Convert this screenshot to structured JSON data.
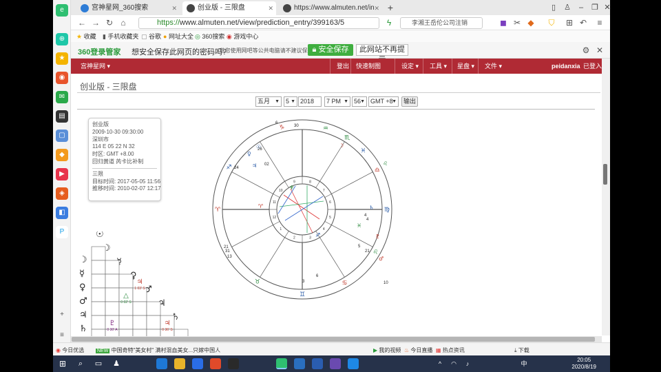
{
  "browser": {
    "tabs": [
      {
        "label": "宫神星网_360搜索"
      },
      {
        "label": "创业版 - 三限盘",
        "active": true
      },
      {
        "label": "https://www.almuten.net/in"
      }
    ],
    "new_tab": "+",
    "url_scheme": "https://",
    "url_rest": "www.almuten.net/view/prediction_entry/399163/5",
    "search_text": "李湘王岳伦公司注销",
    "bookmarks": [
      "收藏",
      "手机收藏夹",
      "谷歌",
      "网址大全",
      "360搜索",
      "游戏中心"
    ]
  },
  "password_bar": {
    "logo": "360登录管家",
    "question": "想安全保存此网页的密码吗?",
    "note": "(若您使用网吧等公共电脑请不建议保存)",
    "save": "安全保存",
    "never": "此网站不再提示"
  },
  "site_nav": {
    "brand": "宫神星网",
    "right_items": [
      "登出",
      "快速制图",
      "设定",
      "工具",
      "星盘",
      "文件"
    ],
    "user": "peidanxia",
    "user_status": "已登入"
  },
  "page": {
    "title": "创业版 - 三限盘",
    "controls": {
      "month": "五月",
      "day": "5",
      "year": "2018",
      "time": "7 PM",
      "minute": "56",
      "tz": "GMT +8",
      "submit": "输出"
    },
    "info": {
      "name": "创业版",
      "datetime": "2009-10-30 09:30:00",
      "place": "深圳市",
      "coords": "114 E 05   22 N 32",
      "tz": "时区: GMT +8.00",
      "house_system": "回归黄道 芮卡比补制",
      "section": "三限",
      "target_time": "目标时间: 2017-05-05 11:56",
      "progressed_time": "推移时间: 2010-02-07 12:17"
    },
    "wheel_labels": {
      "cusp_signs": [
        "♑",
        "♒",
        "♓",
        "♈",
        "♉",
        "♊",
        "♋",
        "♌",
        "♍",
        "♎",
        "♏",
        "♐"
      ],
      "outer_numbers": [
        "6",
        "30",
        "26",
        "24",
        "02",
        "4",
        "21",
        "31",
        "13",
        "21",
        "10",
        "4",
        "5",
        "6",
        "3"
      ],
      "inner_numbers": [
        "11",
        "12",
        "1",
        "2",
        "3",
        "4",
        "5",
        "6",
        "7",
        "8",
        "9",
        "10"
      ]
    },
    "aspect_grid": {
      "row_planets": [
        "☉",
        "☽",
        "☿",
        "♀",
        "♂",
        "♃",
        "♄"
      ],
      "cells": [
        {
          "symbol": "♃",
          "value": "1 03' S"
        },
        {
          "symbol": "△",
          "value": "0 02' S"
        },
        {
          "symbol": "♇",
          "value": "0 30' A"
        },
        {
          "symbol": "♃",
          "value": "0 36' S"
        }
      ]
    },
    "colors": {
      "nav_bg": "#b02a34",
      "accent_red": "#c0392b",
      "accent_blue": "#2e5ea8",
      "accent_green": "#2b8a3e"
    }
  },
  "status_bar": {
    "left": "今日优选",
    "news": "中国奇特\"美女村\" 满村混血美女...只嫁中国人",
    "right_items": [
      "我的视频",
      "今日直播",
      "热点资讯",
      "下载"
    ]
  },
  "taskbar": {
    "time": "20:05",
    "date": "2020/8/19",
    "ime": "中"
  }
}
